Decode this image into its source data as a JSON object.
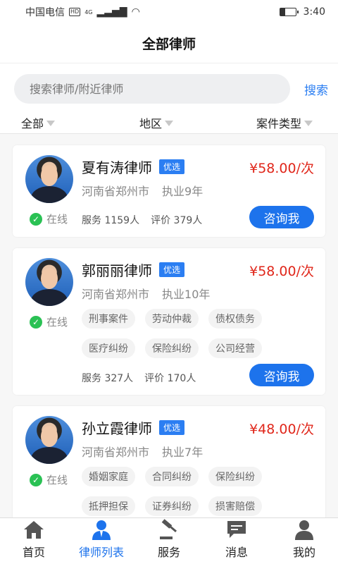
{
  "statusbar": {
    "carrier": "中国电信",
    "hd": "HD",
    "network": "4G",
    "time": "3:40"
  },
  "title": "全部律师",
  "search": {
    "placeholder": "搜索律师/附近律师",
    "button": "搜索"
  },
  "filters": [
    "全部",
    "地区",
    "案件类型"
  ],
  "lawyers": [
    {
      "name": "夏有涛律师",
      "tag": "优选",
      "price": "¥58.00/次",
      "location": "河南省郑州市",
      "experience": "执业9年",
      "status": "在线",
      "chips": [],
      "service": "服务 1159人",
      "rating": "评价 379人",
      "button": "咨询我"
    },
    {
      "name": "郭丽丽律师",
      "tag": "优选",
      "price": "¥58.00/次",
      "location": "河南省郑州市",
      "experience": "执业10年",
      "status": "在线",
      "chips": [
        "刑事案件",
        "劳动仲裁",
        "债权债务",
        "医疗纠纷",
        "保险纠纷",
        "公司经营"
      ],
      "service": "服务 327人",
      "rating": "评价 170人",
      "button": "咨询我"
    },
    {
      "name": "孙立霞律师",
      "tag": "优选",
      "price": "¥48.00/次",
      "location": "河南省郑州市",
      "experience": "执业7年",
      "status": "在线",
      "chips": [
        "婚姻家庭",
        "合同纠纷",
        "保险纠纷",
        "抵押担保",
        "证券纠纷",
        "损害赔偿"
      ],
      "service": "",
      "rating": "",
      "button": ""
    }
  ],
  "tabs": [
    {
      "label": "首页",
      "icon": "home-icon"
    },
    {
      "label": "律师列表",
      "icon": "lawyer-icon",
      "active": true
    },
    {
      "label": "服务",
      "icon": "gavel-icon"
    },
    {
      "label": "消息",
      "icon": "message-icon"
    },
    {
      "label": "我的",
      "icon": "profile-icon"
    }
  ],
  "colors": {
    "accent": "#1d73ec",
    "price": "#e0261a",
    "online": "#2ac154"
  }
}
